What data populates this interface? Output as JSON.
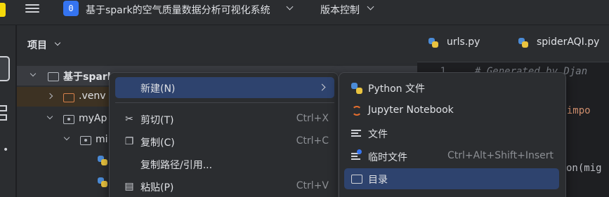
{
  "titlebar": {
    "project_badge": "0",
    "project_name": "基于spark的空气质量数据分析可视化系统",
    "vcs_label": "版本控制"
  },
  "project_panel": {
    "title": "项目",
    "tree": [
      {
        "label": "基于spark"
      },
      {
        "label": ".venv"
      },
      {
        "label": "myAp"
      },
      {
        "label": "mi"
      }
    ]
  },
  "editor": {
    "tabs": [
      {
        "label": "urls.py"
      },
      {
        "label": "spiderAQI.py"
      }
    ],
    "line_number": "1",
    "code": [
      {
        "text": "# Generated by Djan",
        "style": "comment"
      },
      {
        "pre": "b ",
        "kw": "impo"
      },
      {
        "text": "on(mig"
      }
    ]
  },
  "context_menu": {
    "items": [
      {
        "icon": "none",
        "label": "新建(N)",
        "shortcut": "",
        "submenu": true
      },
      {
        "icon": "cut-icon",
        "label": "剪切(T)",
        "shortcut": "Ctrl+X"
      },
      {
        "icon": "copy-icon",
        "label": "复制(C)",
        "shortcut": "Ctrl+C"
      },
      {
        "icon": "none",
        "label": "复制路径/引用...",
        "shortcut": ""
      },
      {
        "icon": "paste-icon",
        "label": "粘贴(P)",
        "shortcut": "Ctrl+V"
      }
    ]
  },
  "new_submenu": {
    "items": [
      {
        "icon": "python-icon",
        "label": "Python 文件",
        "shortcut": ""
      },
      {
        "icon": "jupyter-icon",
        "label": "Jupyter Notebook",
        "shortcut": ""
      },
      {
        "icon": "file-icon",
        "label": "文件",
        "shortcut": ""
      },
      {
        "icon": "scratch-file-icon",
        "label": "临时文件",
        "shortcut": "Ctrl+Alt+Shift+Insert"
      },
      {
        "icon": "directory-icon",
        "label": "目录",
        "shortcut": ""
      }
    ]
  },
  "colors": {
    "accent": "#3574f0",
    "selection": "#2e436e",
    "background": "#1e1f22",
    "panel": "#2b2d30"
  }
}
